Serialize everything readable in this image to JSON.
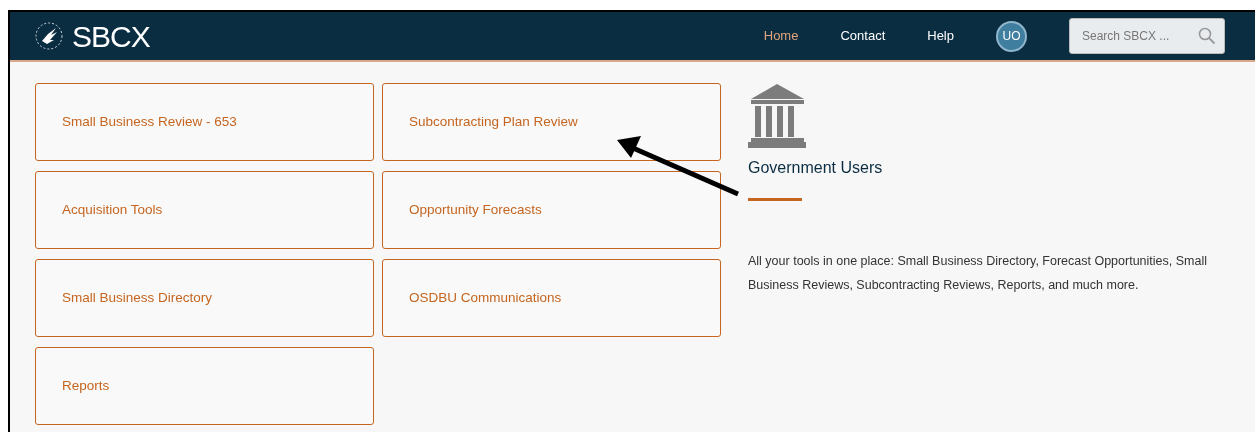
{
  "navbar": {
    "logo_text": "SBCX",
    "links": [
      {
        "label": "Home",
        "selected": true
      },
      {
        "label": "Contact",
        "selected": false
      },
      {
        "label": "Help",
        "selected": false
      }
    ],
    "avatar": "UO",
    "search": {
      "placeholder": "Search SBCX ..."
    }
  },
  "tiles": [
    {
      "label": "Small Business Review - 653"
    },
    {
      "label": "Subcontracting Plan Review"
    },
    {
      "label": "Acquisition Tools"
    },
    {
      "label": "Opportunity Forecasts"
    },
    {
      "label": "Small Business Directory"
    },
    {
      "label": "OSDBU Communications"
    },
    {
      "label": "Reports"
    }
  ],
  "panel": {
    "title": "Government Users",
    "description": "All your tools in one place: Small Business Directory, Forecast Opportunities, Small Business Reviews, Subcontracting Reviews, Reports, and much more."
  }
}
